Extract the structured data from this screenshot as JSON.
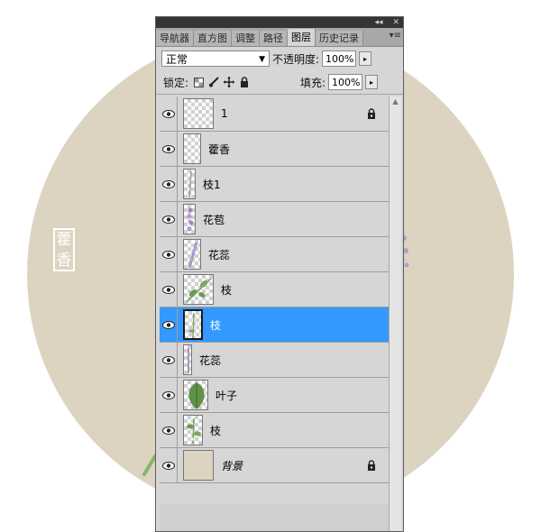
{
  "colors": {
    "artboard": "#ddd3c1",
    "panel_bg": "#d6d6d6",
    "selected_row": "#3399ff",
    "titlebar": "#353535"
  },
  "artwork": {
    "seal_text_line1": "藿",
    "seal_text_line2": "香"
  },
  "panel": {
    "titlebar_buttons": [
      "◂◂",
      "✕"
    ],
    "tabs": [
      {
        "label": "导航器",
        "active": false
      },
      {
        "label": "直方图",
        "active": false
      },
      {
        "label": "调整",
        "active": false
      },
      {
        "label": "路径",
        "active": false
      },
      {
        "label": "图层",
        "active": true
      },
      {
        "label": "历史记录",
        "active": false
      }
    ],
    "tab_menu_icon": "▾≡",
    "blend_mode": "正常",
    "opacity_label": "不透明度:",
    "opacity_value": "100%",
    "lock_label": "锁定:",
    "fill_label": "填充:",
    "fill_value": "100%",
    "arrow": "▸"
  },
  "layers": [
    {
      "name": "1",
      "thumb": "checker",
      "locked": true,
      "selected": false
    },
    {
      "name": "藿香",
      "thumb": "checker-narrow",
      "locked": false,
      "selected": false
    },
    {
      "name": "枝1",
      "thumb": "checker-narrow-stem",
      "locked": false,
      "selected": false
    },
    {
      "name": "花苞",
      "thumb": "checker-narrow-purple",
      "locked": false,
      "selected": false
    },
    {
      "name": "花蕊",
      "thumb": "checker-narrow-purple",
      "locked": false,
      "selected": false
    },
    {
      "name": "枝",
      "thumb": "leaves",
      "locked": false,
      "selected": false
    },
    {
      "name": "枝",
      "thumb": "checker-narrow-flowers",
      "locked": false,
      "selected": true
    },
    {
      "name": "花蕊",
      "thumb": "checker-thin-purple",
      "locked": false,
      "selected": false
    },
    {
      "name": "叶子",
      "thumb": "leaf",
      "locked": false,
      "selected": false
    },
    {
      "name": "枝",
      "thumb": "checker-narrow-green",
      "locked": false,
      "selected": false
    },
    {
      "name": "背景",
      "thumb": "solid",
      "locked": true,
      "selected": false,
      "italic": true
    }
  ]
}
